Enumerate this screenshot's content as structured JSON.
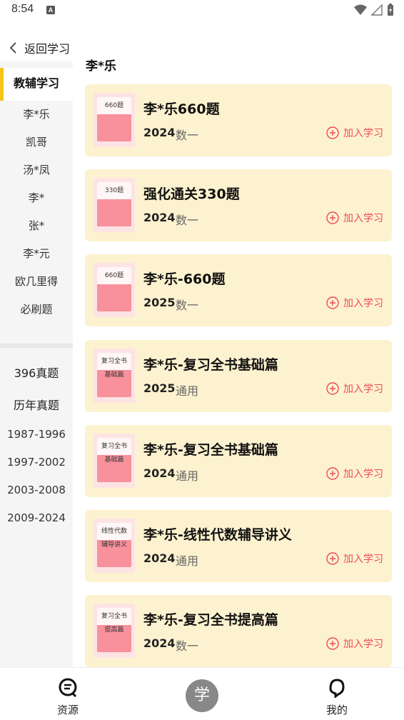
{
  "status": {
    "time": "8:54",
    "notification_letter": "A"
  },
  "header": {
    "back_label": "返回学习"
  },
  "sidebar": {
    "items": [
      {
        "label": "教辅学习",
        "active": true
      },
      {
        "label": "李*乐"
      },
      {
        "label": "凯哥"
      },
      {
        "label": "汤*凤"
      },
      {
        "label": "李*"
      },
      {
        "label": "张*"
      },
      {
        "label": "李*元"
      },
      {
        "label": "欧几里得"
      },
      {
        "label": "必刷题"
      }
    ],
    "exam_items": [
      {
        "label": "396真题"
      },
      {
        "label": "历年真题"
      },
      {
        "label": "1987-1996"
      },
      {
        "label": "1997-2002"
      },
      {
        "label": "2003-2008"
      },
      {
        "label": "2009-2024"
      }
    ]
  },
  "main": {
    "section_title": "李*乐",
    "books": [
      {
        "title": "李*乐660题",
        "year": "2024",
        "subject": "数一",
        "action": "加入学习",
        "cover_line1": "660题",
        "cover_line2": ""
      },
      {
        "title": "强化通关330题",
        "year": "2024",
        "subject": "数一",
        "action": "加入学习",
        "cover_line1": "330题",
        "cover_line2": ""
      },
      {
        "title": "李*乐-660题",
        "year": "2025",
        "subject": "数一",
        "action": "加入学习",
        "cover_line1": "660题",
        "cover_line2": ""
      },
      {
        "title": "李*乐-复习全书基础篇",
        "year": "2025",
        "subject": "通用",
        "action": "加入学习",
        "cover_line1": "复习全书",
        "cover_line2": "基础篇"
      },
      {
        "title": "李*乐-复习全书基础篇",
        "year": "2024",
        "subject": "通用",
        "action": "加入学习",
        "cover_line1": "复习全书",
        "cover_line2": "基础篇"
      },
      {
        "title": "李*乐-线性代数辅导讲义",
        "year": "2024",
        "subject": "通用",
        "action": "加入学习",
        "cover_line1": "线性代数",
        "cover_line2": "辅导讲义"
      },
      {
        "title": "李*乐-复习全书提高篇",
        "year": "2024",
        "subject": "数一",
        "action": "加入学习",
        "cover_line1": "复习全书",
        "cover_line2": "提高篇"
      }
    ]
  },
  "bottom_nav": {
    "resources_label": "资源",
    "study_label": "学",
    "mine_label": "我的"
  },
  "colors": {
    "accent": "#f5c518",
    "card_bg": "#fdf2cf",
    "action_red": "#ee4b55",
    "cover_pink": "#f8919c"
  },
  "icons": {
    "back": "chevron-left-icon",
    "join": "plus-circle-icon",
    "resources": "resources-icon",
    "mine": "profile-icon"
  }
}
